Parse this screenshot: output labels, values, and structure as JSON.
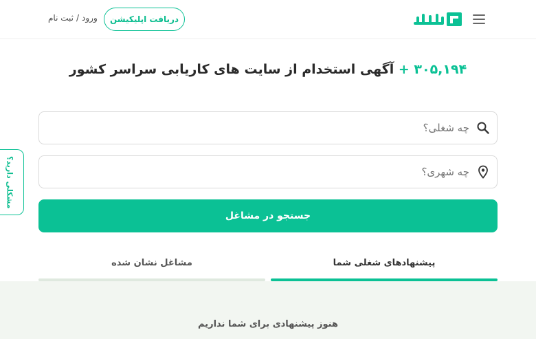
{
  "header": {
    "app_button_label": "دریافت اپلیکیشن",
    "login_label": "ورود",
    "separator": "/",
    "signup_label": "ثبت نام",
    "logo_text": "کاربرد"
  },
  "hero": {
    "count": "۳۰۵,۱۹۴",
    "plus": "+",
    "text": "آگهی استخدام از سایت های کاریابی سراسر کشور"
  },
  "search": {
    "job_placeholder": "چه شغلی؟",
    "city_placeholder": "چه شهری؟",
    "submit_label": "جستجو در مشاغل"
  },
  "side_tab": {
    "label": "مشکلی دارید؟"
  },
  "tabs": [
    {
      "label": "پیشنهادهای شغلی شما",
      "active": true
    },
    {
      "label": "مشاغل نشان شده",
      "active": false
    }
  ],
  "empty_message": "هنوز پیشنهادی برای شما نداریم",
  "colors": {
    "accent": "#0bc195",
    "panel_bg": "#f2f6f1"
  },
  "icons": [
    "hamburger-menu-icon",
    "logo-icon",
    "search-icon",
    "location-pin-icon"
  ]
}
